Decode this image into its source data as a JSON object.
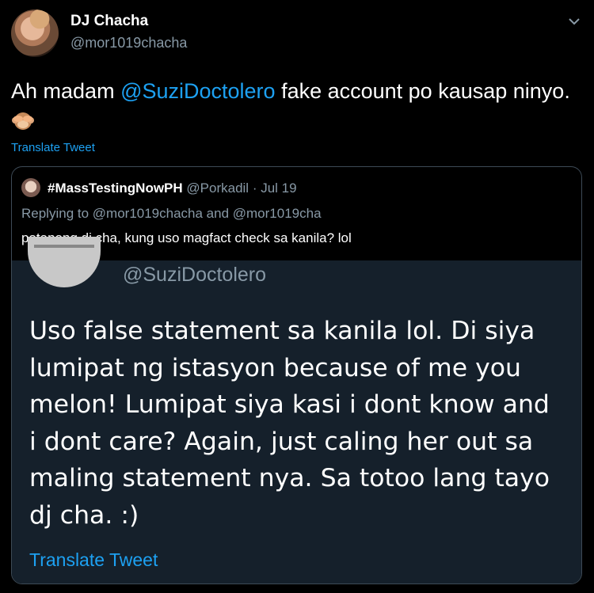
{
  "author": {
    "name": "DJ Chacha",
    "handle": "@mor1019chacha"
  },
  "tweet": {
    "text_before": "Ah madam ",
    "mention": "@SuziDoctolero",
    "text_after": " fake account po kausap ninyo.",
    "emoji": "see-no-evil-monkey",
    "translate_label": "Translate Tweet"
  },
  "quoted_tweet": {
    "name": "#MassTestingNowPH",
    "handle": "@Porkadil",
    "date": " · Jul 19",
    "replying_prefix": "Replying to ",
    "replying_to_1": "@mor1019chacha",
    "replying_and": " and ",
    "replying_to_2": "@mor1019cha",
    "text": "patanong dj cha, kung uso magfact check sa kanila? lol"
  },
  "screenshot": {
    "handle": "@SuziDoctolero",
    "lines": [
      "Uso false statement sa kanila lol.  Di siya",
      "lumipat ng istasyon because of me you",
      "melon!  Lumipat siya kasi i dont know and",
      "i dont care?  Again, just caling her out sa",
      "maling statement nya.  Sa totoo lang tayo",
      "dj cha. :)"
    ],
    "translate_label": "Translate Tweet"
  },
  "colors": {
    "accent": "#1da1f2",
    "muted": "#8899a6",
    "screenshot_bg": "#15202b",
    "border": "#3d4a56"
  }
}
